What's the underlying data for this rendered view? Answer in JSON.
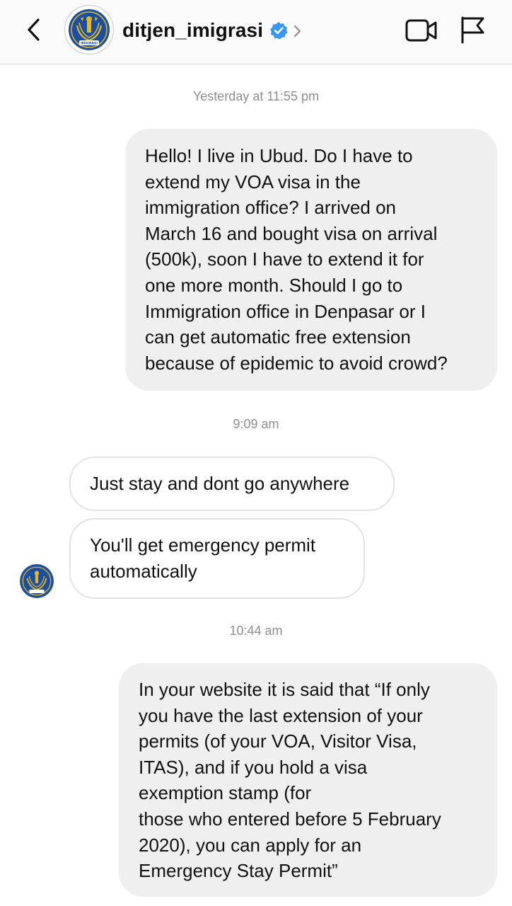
{
  "header": {
    "username": "ditjen_imigrasi",
    "verified": true,
    "icons": {
      "back": "chevron-left-icon",
      "profile_chevron": "chevron-right-icon",
      "video": "video-camera-icon",
      "report": "flag-icon",
      "verified": "verified-badge-icon"
    },
    "avatar_text": "IMIGRASI"
  },
  "colors": {
    "header_bg": "#fafafa",
    "outgoing_bubble": "#efefef",
    "incoming_border": "#e4e4e4",
    "timestamp": "#8e8e8e",
    "verified_badge": "#3897f0",
    "logo_blue": "#1d4fa0",
    "logo_gold": "#e4b825"
  },
  "messages": {
    "timestamp_1": "Yesterday at 11:55 pm",
    "outgoing_1": "Hello! I live in Ubud. Do I have to\nextend my VOA visa in the\nimmigration office? I arrived on\nMarch 16 and bought visa on arrival\n(500k), soon I have to extend it for\none more month. Should I go to\nImmigration office in Denpasar or I\ncan get automatic free extension\nbecause of epidemic to avoid crowd?",
    "timestamp_2": "9:09 am",
    "incoming_1": "Just stay and dont go anywhere",
    "incoming_2": "You'll get emergency permit\nautomatically",
    "timestamp_3": "10:44 am",
    "outgoing_2": "In your website it is said that “If only\nyou have the last extension of your\npermits (of your VOA, Visitor Visa,\nITAS), and if you hold a visa\nexemption stamp (for\nthose who entered before 5 February\n2020), you can apply for an\nEmergency Stay Permit”"
  }
}
